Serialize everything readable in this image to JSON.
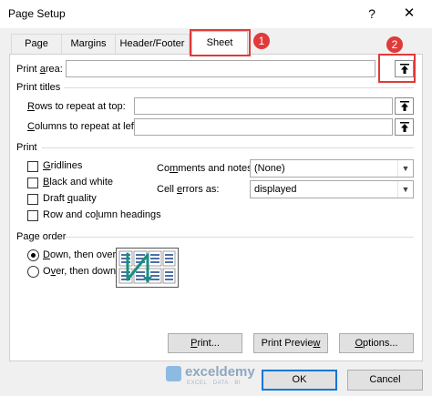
{
  "window": {
    "title": "Page Setup",
    "help_glyph": "?",
    "close_glyph": "✕"
  },
  "tabs": [
    {
      "label": "Page",
      "active": false
    },
    {
      "label": "Margins",
      "active": false
    },
    {
      "label": "Header/Footer",
      "active": false
    },
    {
      "label": "Sheet",
      "active": true
    }
  ],
  "callouts": {
    "one": "1",
    "two": "2"
  },
  "print_area": {
    "label_pre": "Print ",
    "label_u": "a",
    "label_post": "rea:",
    "value": ""
  },
  "print_titles": {
    "heading": "Print titles",
    "rows": {
      "label_u": "R",
      "label_post": "ows to repeat at top:",
      "value": ""
    },
    "cols": {
      "label_u": "C",
      "label_post": "olumns to repeat at left:",
      "value": ""
    }
  },
  "print": {
    "heading": "Print",
    "gridlines": {
      "label_u": "G",
      "label_post": "ridlines",
      "checked": false
    },
    "black_white": {
      "label_u": "B",
      "label_post": "lack and white",
      "checked": false
    },
    "draft": {
      "label_pre": "Draft ",
      "label_u": "q",
      "label_post": "uality",
      "checked": false
    },
    "headings": {
      "label_pre": "Row and co",
      "label_u": "l",
      "label_post": "umn headings",
      "checked": false
    },
    "comments": {
      "label_pre": "Co",
      "label_u": "m",
      "label_post": "ments and notes:",
      "selected": "(None)"
    },
    "cell_errors": {
      "label_pre": "Cell ",
      "label_u": "e",
      "label_post": "rrors as:",
      "selected": "displayed"
    }
  },
  "page_order": {
    "heading": "Page order",
    "down_then_over": {
      "label_u": "D",
      "label_post": "own, then over",
      "selected": true
    },
    "over_then_down": {
      "label_pre": "O",
      "label_u": "v",
      "label_post": "er, then down",
      "selected": false
    }
  },
  "buttons": {
    "print": {
      "label_u": "P",
      "label_post": "rint..."
    },
    "print_preview": {
      "label_pre": "Print Previe",
      "label_u": "w",
      "label_post": ""
    },
    "options": {
      "label_u": "O",
      "label_post": "ptions..."
    },
    "ok": "OK",
    "cancel": "Cancel"
  },
  "watermark": {
    "name": "exceldemy",
    "tagline": "EXCEL · DATA · BI"
  },
  "colors": {
    "callout": "#e03a3a",
    "preview_arrow": "#1a8f7e",
    "default_button_border": "#0078d7"
  }
}
